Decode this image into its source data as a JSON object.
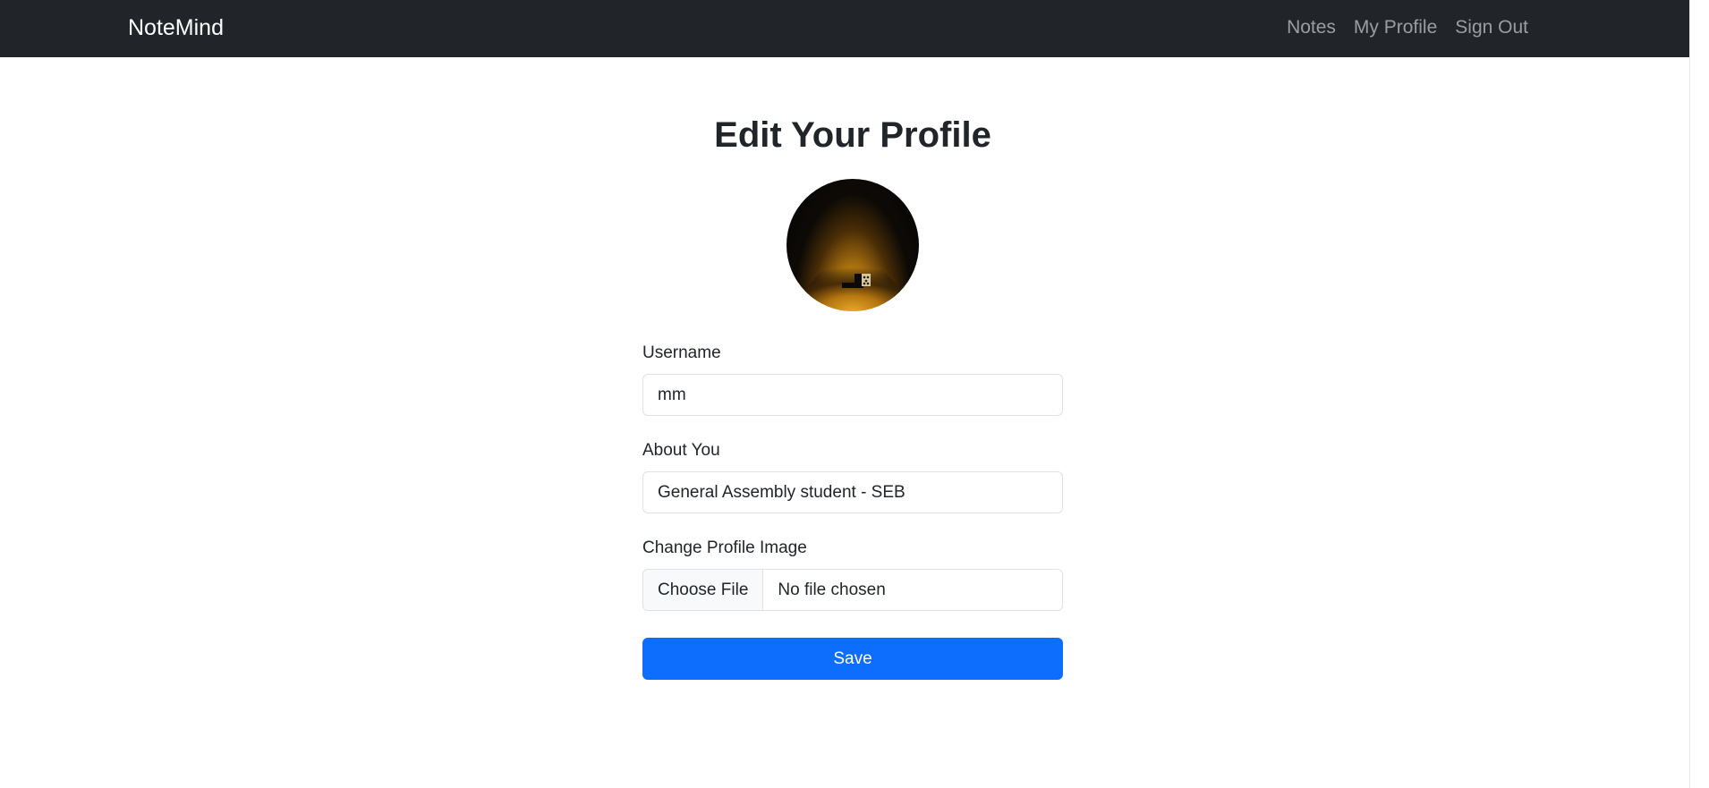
{
  "navbar": {
    "brand": "NoteMind",
    "links": [
      "Notes",
      "My Profile",
      "Sign Out"
    ]
  },
  "page": {
    "title": "Edit Your Profile"
  },
  "avatar": {
    "icon": "profile-photo-dark-hallway-with-dice"
  },
  "form": {
    "username_label": "Username",
    "username_value": "mm",
    "about_label": "About You",
    "about_value": "General Assembly student - SEB",
    "image_label": "Change Profile Image",
    "file_button": "Choose File",
    "file_status": "No file chosen",
    "save_label": "Save"
  },
  "colors": {
    "navbar_bg": "#212529",
    "primary": "#0d6efd"
  }
}
